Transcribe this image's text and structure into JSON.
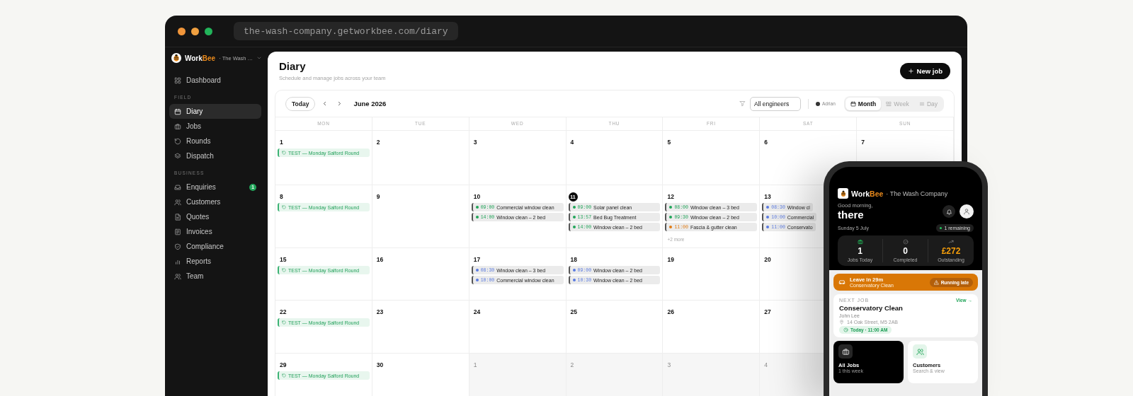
{
  "browser": {
    "url": "the-wash-company.getworkbee.com/diary"
  },
  "sidebar": {
    "brand": {
      "name_start": "Work",
      "name_accent": "Bee",
      "workspace": "· The Wash …"
    },
    "sections": [
      {
        "items": [
          {
            "label": "Dashboard",
            "selected": false
          }
        ]
      },
      {
        "heading": "FIELD",
        "items": [
          {
            "label": "Diary",
            "selected": true
          },
          {
            "label": "Jobs",
            "selected": false
          },
          {
            "label": "Rounds",
            "selected": false
          },
          {
            "label": "Dispatch",
            "selected": false
          }
        ]
      },
      {
        "heading": "BUSINESS",
        "items": [
          {
            "label": "Enquiries",
            "selected": false,
            "badge": "1"
          },
          {
            "label": "Customers",
            "selected": false
          },
          {
            "label": "Quotes",
            "selected": false
          },
          {
            "label": "Invoices",
            "selected": false
          },
          {
            "label": "Compliance",
            "selected": false
          },
          {
            "label": "Reports",
            "selected": false
          },
          {
            "label": "Team",
            "selected": false
          }
        ]
      }
    ]
  },
  "header": {
    "title": "Diary",
    "subtitle": "Schedule and manage jobs across your team",
    "new_button": "New job"
  },
  "toolbar": {
    "today": "Today",
    "month_label": "June 2026",
    "engineer_filter": {
      "value": "All engineers"
    },
    "legend": "Adrian",
    "views": [
      {
        "label": "Month",
        "selected": true
      },
      {
        "label": "Week",
        "selected": false
      },
      {
        "label": "Day",
        "selected": false
      }
    ]
  },
  "calendar": {
    "weekdays": [
      "MON",
      "TUE",
      "WED",
      "THU",
      "FRI",
      "SAT",
      "SUN"
    ],
    "weeks": [
      {
        "days": [
          {
            "day": "1",
            "today": false,
            "outside": false,
            "events": [
              {
                "kind": "round",
                "title": "TEST — Monday Salford Round"
              }
            ]
          },
          {
            "day": "2",
            "today": false,
            "outside": false
          },
          {
            "day": "3",
            "today": false,
            "outside": false
          },
          {
            "day": "4",
            "today": false,
            "outside": false
          },
          {
            "day": "5",
            "today": false,
            "outside": false
          },
          {
            "day": "6",
            "today": false,
            "outside": false
          },
          {
            "day": "7",
            "today": false,
            "outside": false
          }
        ]
      },
      {
        "days": [
          {
            "day": "8",
            "today": false,
            "outside": false,
            "events": [
              {
                "kind": "round",
                "title": "TEST — Monday Salford Round"
              }
            ]
          },
          {
            "day": "9",
            "today": false,
            "outside": false
          },
          {
            "day": "10",
            "today": false,
            "outside": false,
            "events": [
              {
                "kind": "job",
                "time": "09:00",
                "title": "Commercial window clean",
                "color": "#22a55a"
              },
              {
                "kind": "job",
                "time": "14:00",
                "title": "Window clean – 2 bed",
                "color": "#22a55a"
              }
            ]
          },
          {
            "day": "11",
            "today": true,
            "outside": false,
            "events": [
              {
                "kind": "job",
                "time": "09:00",
                "title": "Solar panel clean",
                "color": "#22a55a"
              },
              {
                "kind": "job",
                "time": "13:57",
                "title": "Bed Bug Treatment",
                "color": "#22a55a"
              },
              {
                "kind": "job",
                "time": "14:00",
                "title": "Window clean – 2 bed",
                "color": "#22a55a"
              }
            ]
          },
          {
            "day": "12",
            "today": false,
            "outside": false,
            "events": [
              {
                "kind": "job",
                "time": "08:00",
                "title": "Window clean – 3 bed",
                "color": "#22a55a"
              },
              {
                "kind": "job",
                "time": "09:30",
                "title": "Window clean – 2 bed",
                "color": "#22a55a"
              },
              {
                "kind": "job",
                "time": "11:00",
                "title": "Fascia & gutter clean",
                "color": "#e07b14"
              }
            ],
            "more": "+2 more"
          },
          {
            "day": "13",
            "today": false,
            "outside": false,
            "events": [
              {
                "kind": "job",
                "time": "08:30",
                "title": "Window cl",
                "color": "#5b7be0"
              },
              {
                "kind": "job",
                "time": "10:00",
                "title": "Commercial",
                "color": "#5b7be0"
              },
              {
                "kind": "job",
                "time": "11:00",
                "title": "Conservato",
                "color": "#5b7be0"
              }
            ]
          }
        ]
      },
      {
        "days": [
          {
            "day": "15",
            "today": false,
            "outside": false,
            "events": [
              {
                "kind": "round",
                "title": "TEST — Monday Salford Round"
              }
            ]
          },
          {
            "day": "16",
            "today": false,
            "outside": false
          },
          {
            "day": "17",
            "today": false,
            "outside": false,
            "events": [
              {
                "kind": "job",
                "time": "08:30",
                "title": "Window clean – 3 bed",
                "color": "#5b7be0"
              },
              {
                "kind": "job",
                "time": "10:00",
                "title": "Commercial window clean",
                "color": "#5b7be0"
              }
            ]
          },
          {
            "day": "18",
            "today": false,
            "outside": false,
            "events": [
              {
                "kind": "job",
                "time": "09:00",
                "title": "Window clean – 2 bed",
                "color": "#5b7be0"
              },
              {
                "kind": "job",
                "time": "10:30",
                "title": "Window clean – 2 bed",
                "color": "#5b7be0"
              }
            ]
          },
          {
            "day": "19",
            "today": false,
            "outside": false
          },
          {
            "day": "20",
            "today": false,
            "outside": false
          }
        ]
      },
      {
        "days": [
          {
            "day": "22",
            "today": false,
            "outside": false,
            "events": [
              {
                "kind": "round",
                "title": "TEST — Monday Salford Round"
              }
            ]
          },
          {
            "day": "23",
            "today": false,
            "outside": false
          },
          {
            "day": "24",
            "today": false,
            "outside": false
          },
          {
            "day": "25",
            "today": false,
            "outside": false
          },
          {
            "day": "26",
            "today": false,
            "outside": false
          },
          {
            "day": "27",
            "today": false,
            "outside": false
          }
        ]
      },
      {
        "days": [
          {
            "day": "29",
            "today": false,
            "outside": false,
            "events": [
              {
                "kind": "round",
                "title": "TEST — Monday Salford Round"
              }
            ]
          },
          {
            "day": "30",
            "today": false,
            "outside": false
          },
          {
            "day": "1",
            "today": false,
            "outside": true
          },
          {
            "day": "2",
            "today": false,
            "outside": true
          },
          {
            "day": "3",
            "today": false,
            "outside": true
          },
          {
            "day": "4",
            "today": false,
            "outside": true
          }
        ]
      }
    ]
  },
  "phone": {
    "brand": {
      "name_start": "Work",
      "name_accent": "Bee",
      "company": "· The Wash Company"
    },
    "greeting": "Good morning,",
    "name": "there",
    "date": "Sunday 5 July",
    "remaining": "1 remaining",
    "stats": [
      {
        "kind": "jobs",
        "value": "1",
        "label": "Jobs Today"
      },
      {
        "kind": "done",
        "value": "0",
        "label": "Completed"
      },
      {
        "kind": "money",
        "value": "£272",
        "label": "Outstanding"
      }
    ],
    "alert": {
      "title": "Leave in 29m",
      "subtitle": "Conservatory Clean",
      "button": "Running late"
    },
    "next_job": {
      "heading": "NEXT JOB",
      "link": "View →",
      "title": "Conservatory Clean",
      "customer": "John Lee",
      "address": "14 Oak Street, M5 2AB",
      "when": "Today · 11:00 AM"
    },
    "tiles": [
      {
        "kind": "dark",
        "title": "All Jobs",
        "subtitle": "1 this week"
      },
      {
        "kind": "light",
        "title": "Customers",
        "subtitle": "Search & view"
      }
    ]
  }
}
